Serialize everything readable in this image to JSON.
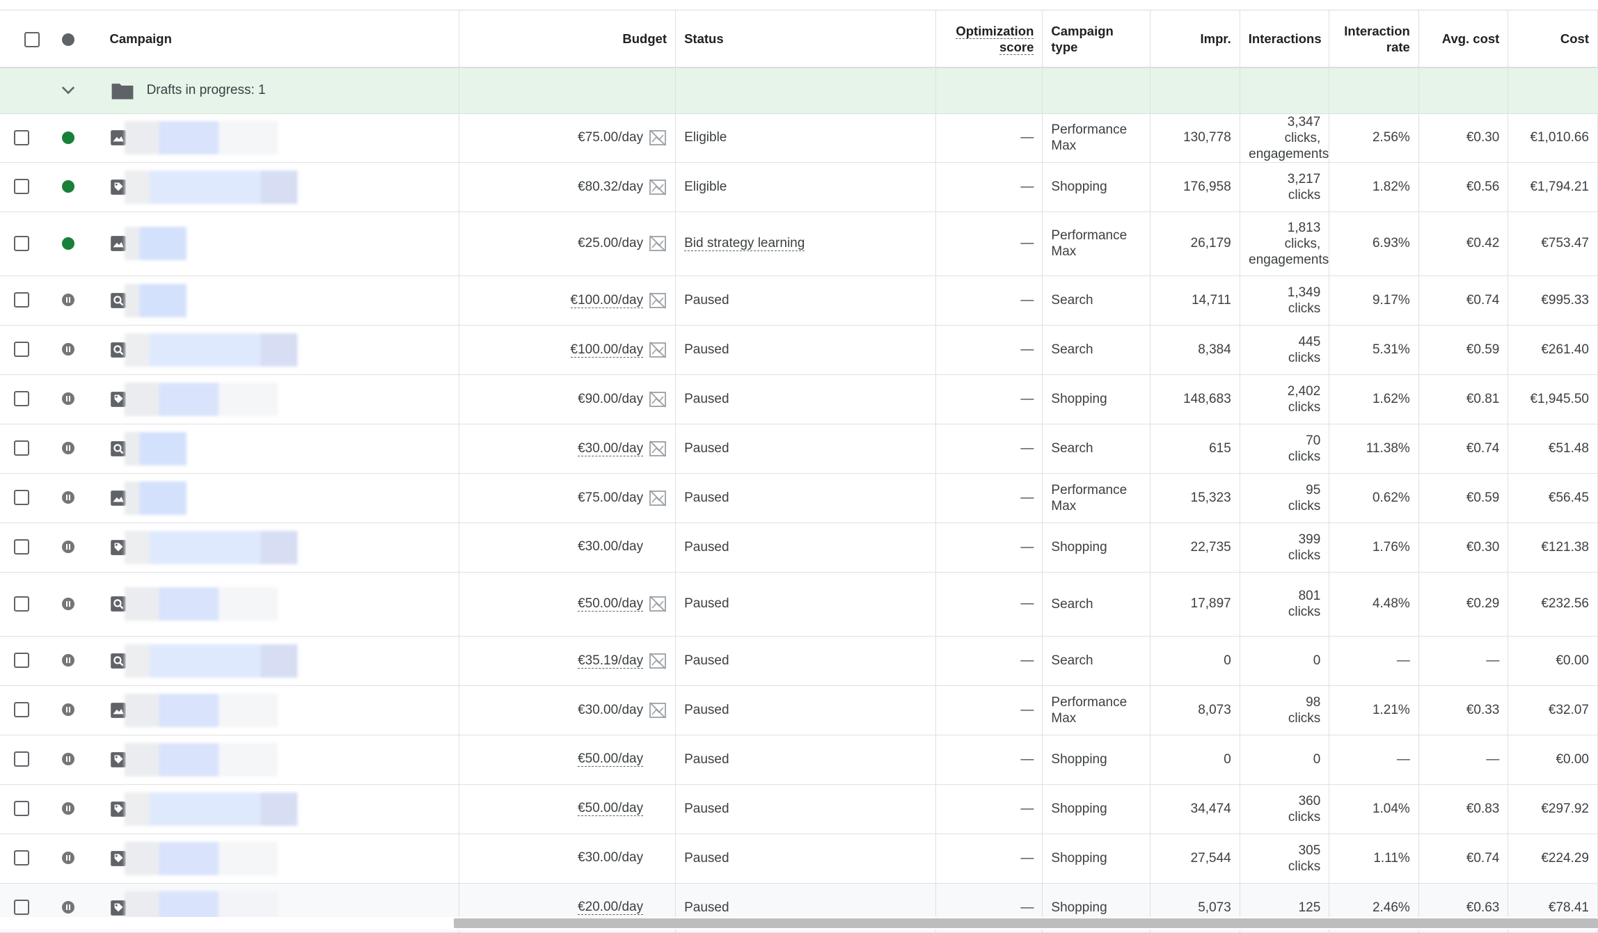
{
  "columns": {
    "campaign": "Campaign",
    "budget": "Budget",
    "status": "Status",
    "optimization_score": "Optimization score",
    "optimization_score_line1": "Optimization",
    "optimization_score_line2": "score",
    "campaign_type_line1": "Campaign",
    "campaign_type_line2": "type",
    "impr": "Impr.",
    "interactions": "Interactions",
    "interaction_rate_line1": "Interaction",
    "interaction_rate_line2": "rate",
    "avg_cost": "Avg. cost",
    "cost": "Cost"
  },
  "group": {
    "label": "Drafts in progress: 1"
  },
  "rows": [
    {
      "status_dot": "enabled",
      "icon": "image",
      "budget": "€75.00/day",
      "status": "Eligible",
      "opt": "—",
      "type": "Performance Max",
      "impr": "130,778",
      "interactions": "3,347 clicks, engagements",
      "rate": "2.56%",
      "avg": "€0.30",
      "cost": "€1,010.66"
    },
    {
      "status_dot": "enabled",
      "icon": "tag",
      "budget": "€80.32/day",
      "status": "Eligible",
      "opt": "—",
      "type": "Shopping",
      "impr": "176,958",
      "interactions": "3,217 clicks",
      "rate": "1.82%",
      "avg": "€0.56",
      "cost": "€1,794.21"
    },
    {
      "status_dot": "enabled",
      "icon": "image",
      "budget": "€25.00/day",
      "status": "Bid strategy learning",
      "opt": "—",
      "type": "Performance Max",
      "impr": "26,179",
      "interactions": "1,813 clicks, engagements",
      "rate": "6.93%",
      "avg": "€0.42",
      "cost": "€753.47"
    },
    {
      "status_dot": "paused",
      "icon": "search",
      "budget": "€100.00/day",
      "status": "Paused",
      "opt": "—",
      "type": "Search",
      "impr": "14,711",
      "interactions": "1,349 clicks",
      "rate": "9.17%",
      "avg": "€0.74",
      "cost": "€995.33"
    },
    {
      "status_dot": "paused",
      "icon": "search",
      "budget": "€100.00/day",
      "status": "Paused",
      "opt": "—",
      "type": "Search",
      "impr": "8,384",
      "interactions": "445 clicks",
      "rate": "5.31%",
      "avg": "€0.59",
      "cost": "€261.40"
    },
    {
      "status_dot": "paused",
      "icon": "tag",
      "budget": "€90.00/day",
      "status": "Paused",
      "opt": "—",
      "type": "Shopping",
      "impr": "148,683",
      "interactions": "2,402 clicks",
      "rate": "1.62%",
      "avg": "€0.81",
      "cost": "€1,945.50"
    },
    {
      "status_dot": "paused",
      "icon": "search",
      "budget": "€30.00/day",
      "status": "Paused",
      "opt": "—",
      "type": "Search",
      "impr": "615",
      "interactions": "70 clicks",
      "rate": "11.38%",
      "avg": "€0.74",
      "cost": "€51.48"
    },
    {
      "status_dot": "paused",
      "icon": "image",
      "budget": "€75.00/day",
      "status": "Paused",
      "opt": "—",
      "type": "Performance Max",
      "impr": "15,323",
      "interactions": "95 clicks",
      "rate": "0.62%",
      "avg": "€0.59",
      "cost": "€56.45"
    },
    {
      "status_dot": "paused",
      "icon": "tag",
      "budget": "€30.00/day",
      "status": "Paused",
      "opt": "—",
      "type": "Shopping",
      "impr": "22,735",
      "interactions": "399 clicks",
      "rate": "1.76%",
      "avg": "€0.30",
      "cost": "€121.38"
    },
    {
      "status_dot": "paused",
      "icon": "search",
      "budget": "€50.00/day",
      "status": "Paused",
      "opt": "—",
      "type": "Search",
      "impr": "17,897",
      "interactions": "801 clicks",
      "rate": "4.48%",
      "avg": "€0.29",
      "cost": "€232.56"
    },
    {
      "status_dot": "paused",
      "icon": "search",
      "budget": "€35.19/day",
      "status": "Paused",
      "opt": "—",
      "type": "Search",
      "impr": "0",
      "interactions": "0",
      "rate": "—",
      "avg": "—",
      "cost": "€0.00"
    },
    {
      "status_dot": "paused",
      "icon": "image",
      "budget": "€30.00/day",
      "status": "Paused",
      "opt": "—",
      "type": "Performance Max",
      "impr": "8,073",
      "interactions": "98 clicks",
      "rate": "1.21%",
      "avg": "€0.33",
      "cost": "€32.07"
    },
    {
      "status_dot": "paused",
      "icon": "tag",
      "budget": "€50.00/day",
      "status": "Paused",
      "opt": "—",
      "type": "Shopping",
      "impr": "0",
      "interactions": "0",
      "rate": "—",
      "avg": "—",
      "cost": "€0.00"
    },
    {
      "status_dot": "paused",
      "icon": "tag",
      "budget": "€50.00/day",
      "status": "Paused",
      "opt": "—",
      "type": "Shopping",
      "impr": "34,474",
      "interactions": "360 clicks",
      "rate": "1.04%",
      "avg": "€0.83",
      "cost": "€297.92"
    },
    {
      "status_dot": "paused",
      "icon": "tag",
      "budget": "€30.00/day",
      "status": "Paused",
      "opt": "—",
      "type": "Shopping",
      "impr": "27,544",
      "interactions": "305 clicks",
      "rate": "1.11%",
      "avg": "€0.74",
      "cost": "€224.29"
    },
    {
      "status_dot": "paused",
      "icon": "tag",
      "budget": "€20.00/day",
      "status": "Paused",
      "opt": "—",
      "type": "Shopping",
      "impr": "5,073",
      "interactions": "125",
      "rate": "2.46%",
      "avg": "€0.63",
      "cost": "€78.41"
    }
  ],
  "colors": {
    "enabled": "#188038",
    "paused": "#757575",
    "group_bg": "#e6f4ea"
  },
  "icons": {
    "image": "image-icon",
    "tag": "tag-icon",
    "search": "search-campaign-icon",
    "no_chart": "no-chart-icon",
    "folder": "folder-icon",
    "chevron": "chevron-down-icon"
  }
}
